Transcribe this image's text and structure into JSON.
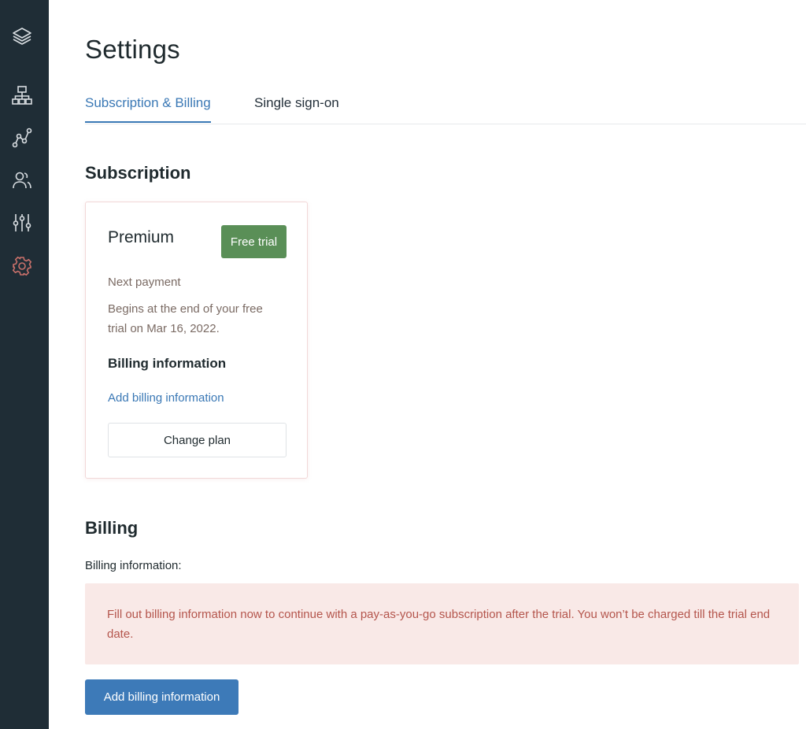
{
  "sidebar": {
    "items": [
      {
        "icon": "layers-icon"
      },
      {
        "icon": "sitemap-icon"
      },
      {
        "icon": "graph-nodes-icon"
      },
      {
        "icon": "users-icon"
      },
      {
        "icon": "sliders-icon"
      },
      {
        "icon": "gear-icon",
        "active": true,
        "color": "#c8706a"
      }
    ]
  },
  "page": {
    "title": "Settings"
  },
  "tabs": [
    {
      "label": "Subscription & Billing",
      "active": true
    },
    {
      "label": "Single sign-on",
      "active": false
    }
  ],
  "subscription": {
    "heading": "Subscription",
    "card": {
      "plan_name": "Premium",
      "badge": "Free trial",
      "next_payment_label": "Next payment",
      "next_payment_text": "Begins at the end of your free trial on Mar 16, 2022.",
      "billing_heading": "Billing information",
      "add_billing_link": "Add billing information",
      "change_plan_label": "Change plan"
    }
  },
  "billing": {
    "heading": "Billing",
    "label": "Billing information:",
    "alert": "Fill out billing information now to continue with a pay-as-you-go subscription after the trial. You won’t be charged till the trial end date.",
    "button_label": "Add billing information"
  },
  "colors": {
    "sidebar_bg": "#1f2d36",
    "accent": "#3a78b5",
    "badge_green": "#5a8f57",
    "alert_bg": "#f9e9e7",
    "alert_text": "#b4554c"
  }
}
